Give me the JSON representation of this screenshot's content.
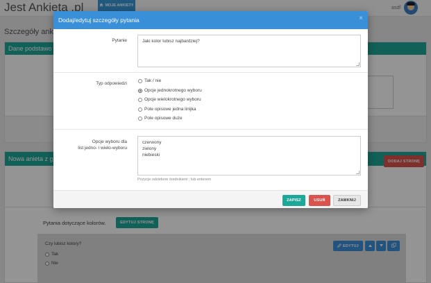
{
  "app": {
    "brand": "Jest Ankieta .pl",
    "user": "asdf"
  },
  "nav": {
    "tab_label": "MOJE ANKIETY",
    "tab_icon": "home-icon"
  },
  "page": {
    "title": "Szczegóły ank"
  },
  "panel1": {
    "title": "Dane podstawo"
  },
  "panel2": {
    "title": "Nowa anieta z g",
    "add_page_label": "DODAJ STRONĘ"
  },
  "questions_section": {
    "label": "Pytania dotyczące kolorów.",
    "edit_page_label": "EDYTUJ STRONĘ"
  },
  "question_card": {
    "title": "Czy lubisz kolory?",
    "options": [
      "Tak",
      "Nie"
    ],
    "edit_label": "EDYTUJ",
    "edit_icon": "pencil-icon"
  },
  "modal": {
    "title": "Dodaj/edytuj szczegóły pytania",
    "close": "×",
    "question_label": "Pytanie",
    "question_value": "Jaki kolor lubisz najbardziej?",
    "type_label": "Typ odpowiedzi",
    "types": [
      {
        "label": "Tak / nie",
        "checked": false
      },
      {
        "label": "Opcje jednokrotnego wyboru",
        "checked": true
      },
      {
        "label": "Opcje wielokrotnego wyboru",
        "checked": false
      },
      {
        "label": "Pole opisowe jedna linijka",
        "checked": false
      },
      {
        "label": "Pole opisowe duże",
        "checked": false
      }
    ],
    "choices_label_line1": "Opcje wyboru dla",
    "choices_label_line2": "list jedno- i wielo-wyboru",
    "choices": [
      "czerwony",
      "zielony",
      "niebieski"
    ],
    "hint": "Pozycje odzielone średnikiem ; lub enterem",
    "save_label": "ZAPISZ",
    "delete_label": "USUŃ",
    "close_label": "ZAMKNIJ"
  },
  "colors": {
    "accent": "#1fa79a",
    "primary": "#3a8fd9",
    "danger": "#d9534f"
  }
}
